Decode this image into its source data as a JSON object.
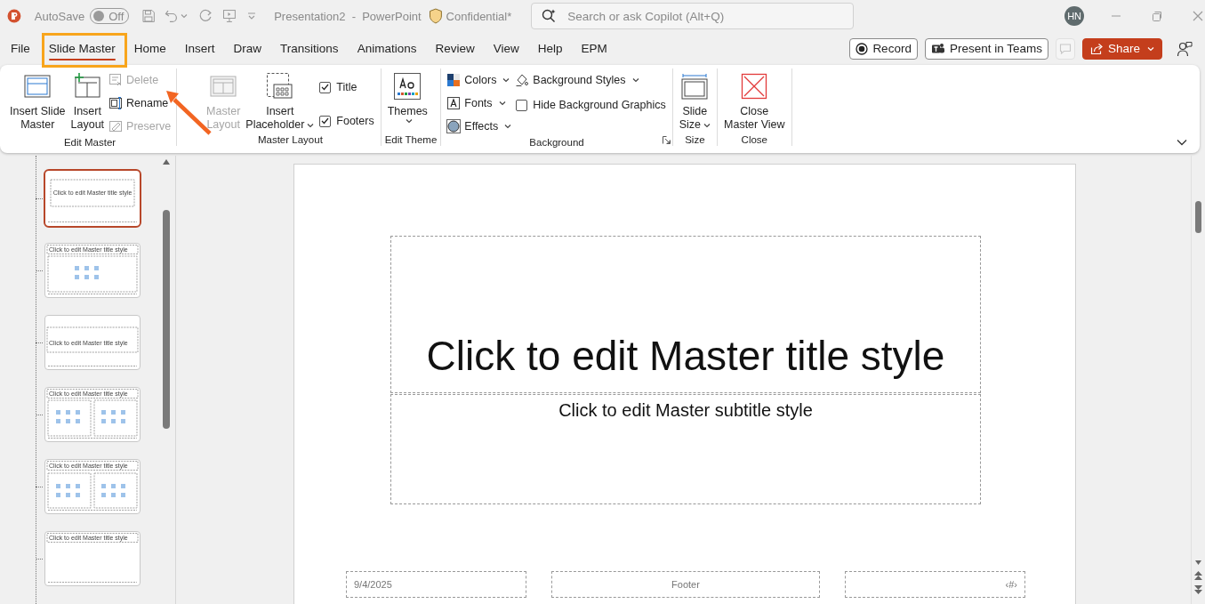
{
  "titlebar": {
    "autosave_label": "AutoSave",
    "autosave": {
      "on": false,
      "label": "Off"
    },
    "document_title": "Presentation2  -  PowerPoint",
    "sensitivity": "Confidential*",
    "search": {
      "placeholder": "Search or ask Copilot (Alt+Q)"
    },
    "user_initials": "HN"
  },
  "tabs": [
    {
      "label": "File",
      "selected": false
    },
    {
      "label": "Slide Master",
      "selected": true
    },
    {
      "label": "Home",
      "selected": false
    },
    {
      "label": "Insert",
      "selected": false
    },
    {
      "label": "Draw",
      "selected": false
    },
    {
      "label": "Transitions",
      "selected": false
    },
    {
      "label": "Animations",
      "selected": false
    },
    {
      "label": "Review",
      "selected": false
    },
    {
      "label": "View",
      "selected": false
    },
    {
      "label": "Help",
      "selected": false
    },
    {
      "label": "EPM",
      "selected": false
    }
  ],
  "tab_actions": {
    "record": "Record",
    "present": "Present in Teams",
    "comments": {
      "disabled": true
    },
    "share": "Share"
  },
  "ribbon": {
    "groups": [
      {
        "label": "Edit Master",
        "columns": [
          [
            {
              "kind": "large",
              "lines": [
                "Insert Slide",
                "Master"
              ],
              "disabled": false
            }
          ],
          [
            {
              "kind": "large",
              "lines": [
                "Insert",
                "Layout"
              ],
              "disabled": false
            }
          ],
          [
            {
              "kind": "small",
              "label": "Delete",
              "disabled": true
            },
            {
              "kind": "small",
              "label": "Rename",
              "disabled": false
            },
            {
              "kind": "small",
              "label": "Preserve",
              "disabled": true
            }
          ]
        ]
      },
      {
        "label": "Master Layout",
        "columns": [
          [
            {
              "kind": "large",
              "lines": [
                "Master",
                "Layout"
              ],
              "disabled": true
            }
          ],
          [
            {
              "kind": "large",
              "lines": [
                "Insert",
                "Placeholder"
              ],
              "dropdown": true,
              "disabled": false
            }
          ],
          [
            {
              "kind": "check",
              "label": "Title",
              "checked": true
            },
            {
              "kind": "check",
              "label": "Footers",
              "checked": true
            }
          ]
        ]
      },
      {
        "label": "Edit Theme",
        "columns": [
          [
            {
              "kind": "large",
              "lines": [
                "Themes"
              ],
              "dropdown": true,
              "disabled": false
            }
          ]
        ]
      },
      {
        "label": "Background",
        "launcher": true,
        "columns": [
          [
            {
              "kind": "small",
              "label": "Colors",
              "dropdown": true,
              "disabled": false
            },
            {
              "kind": "small",
              "label": "Fonts",
              "dropdown": true,
              "disabled": false
            },
            {
              "kind": "small",
              "label": "Effects",
              "dropdown": true,
              "disabled": false
            }
          ],
          [
            {
              "kind": "small",
              "label": "Background Styles",
              "dropdown": true,
              "disabled": false
            },
            {
              "kind": "check",
              "label": "Hide Background Graphics",
              "checked": false
            }
          ]
        ]
      },
      {
        "label": "Size",
        "columns": [
          [
            {
              "kind": "large",
              "lines": [
                "Slide",
                "Size"
              ],
              "dropdown": true,
              "disabled": false
            }
          ]
        ]
      },
      {
        "label": "Close",
        "columns": [
          [
            {
              "kind": "large",
              "lines": [
                "Close",
                "Master View"
              ],
              "disabled": false
            }
          ]
        ]
      }
    ]
  },
  "thumbnails": [
    {
      "kind": "title",
      "title": "Click to edit Master title style",
      "selected": true
    },
    {
      "kind": "content",
      "title": "Click to edit Master title style",
      "selected": false
    },
    {
      "kind": "section",
      "title": "Click to edit Master title style",
      "selected": false
    },
    {
      "kind": "two",
      "title": "Click to edit Master title style",
      "selected": false
    },
    {
      "kind": "comparison",
      "title": "Click to edit Master title style",
      "selected": false
    },
    {
      "kind": "title_only",
      "title": "Click to edit Master title style",
      "selected": false
    }
  ],
  "slide": {
    "title": "Click to edit Master title style",
    "subtitle": "Click to edit Master subtitle style",
    "date": "9/4/2025",
    "footer": "Footer",
    "page_number": "‹#›"
  },
  "annotations": {
    "highlight_box": true,
    "arrow": true
  }
}
